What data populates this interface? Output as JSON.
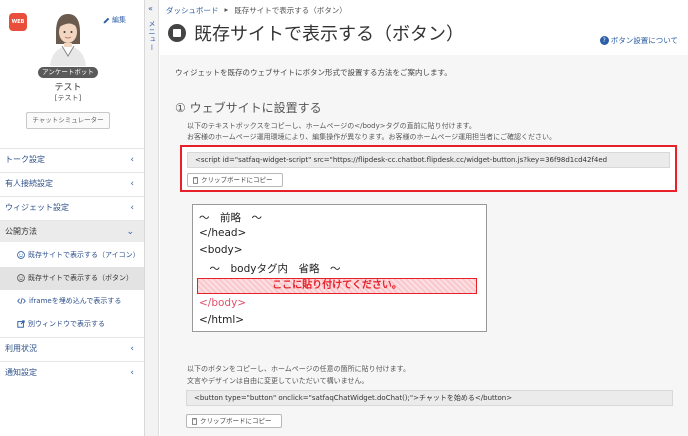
{
  "sidebar": {
    "web_badge": "WEB",
    "edit_label": "編集",
    "role_badge": "アンケートボット",
    "user_name": "テスト",
    "user_sub": "[テスト]",
    "chat_sim_label": "チャットシミュレーター",
    "nav": [
      {
        "label": "トーク設定"
      },
      {
        "label": "有人接続設定"
      },
      {
        "label": "ウィジェット設定"
      },
      {
        "label": "公開方法"
      }
    ],
    "sub_items": [
      {
        "label": "既存サイトで表示する（アイコン）",
        "icon": "smiley-icon"
      },
      {
        "label": "既存サイトで表示する（ボタン）",
        "icon": "smiley-icon"
      },
      {
        "label": "iframeを埋め込んで表示する",
        "icon": "code-icon"
      },
      {
        "label": "別ウィンドウで表示する",
        "icon": "external-window-icon"
      }
    ],
    "nav_bottom": [
      {
        "label": "利用状況"
      },
      {
        "label": "通知設定"
      }
    ]
  },
  "menu_strip": {
    "label": "メニュー"
  },
  "main": {
    "breadcrumb": {
      "home": "ダッシュボード",
      "current": "既存サイトで表示する（ボタン）"
    },
    "title": "既存サイトで表示する（ボタン）",
    "help_link": "ボタン設置について",
    "intro": "ウィジェットを既存のウェブサイトにボタン形式で設置する方法をご案内します。",
    "step1": {
      "title": "① ウェブサイトに設置する",
      "desc1": "以下のテキストボックスをコピーし、ホームページの</body>タグの直前に貼り付けます。",
      "desc2": "お客様のホームページ運用環境により、編集操作が異なります。お客様のホームページ運用担当者にご確認ください。",
      "code": "<script id=\"satfaq-widget-script\" src=\"https://flipdesk-cc.chatbot.flipdesk.cc/widget-button.js?key=36f98d1cd42f4ed",
      "copy_label": "クリップボードにコピー"
    },
    "example": {
      "l1": "〜　前略　〜",
      "l2": "</head>",
      "l3": "<body>",
      "l4": "　〜　bodyタグ内　省略　〜",
      "highlight": "ここに貼り付けてください。",
      "l5": "</body>",
      "l6": "</html>"
    },
    "step2": {
      "desc1": "以下のボタンをコピーし、ホームページの任意の箇所に貼り付けます。",
      "desc2": "文言やデザインは自由に変更していただいて構いません。",
      "code": "<button type=\"button\" onclick=\"satfaqChatWidget.doChat();\">チャットを始める</button>",
      "copy_label": "クリップボードにコピー"
    }
  },
  "colors": {
    "accent": "#2d5fa6",
    "highlight_red": "#e8202a",
    "web_badge": "#e94e3c"
  }
}
